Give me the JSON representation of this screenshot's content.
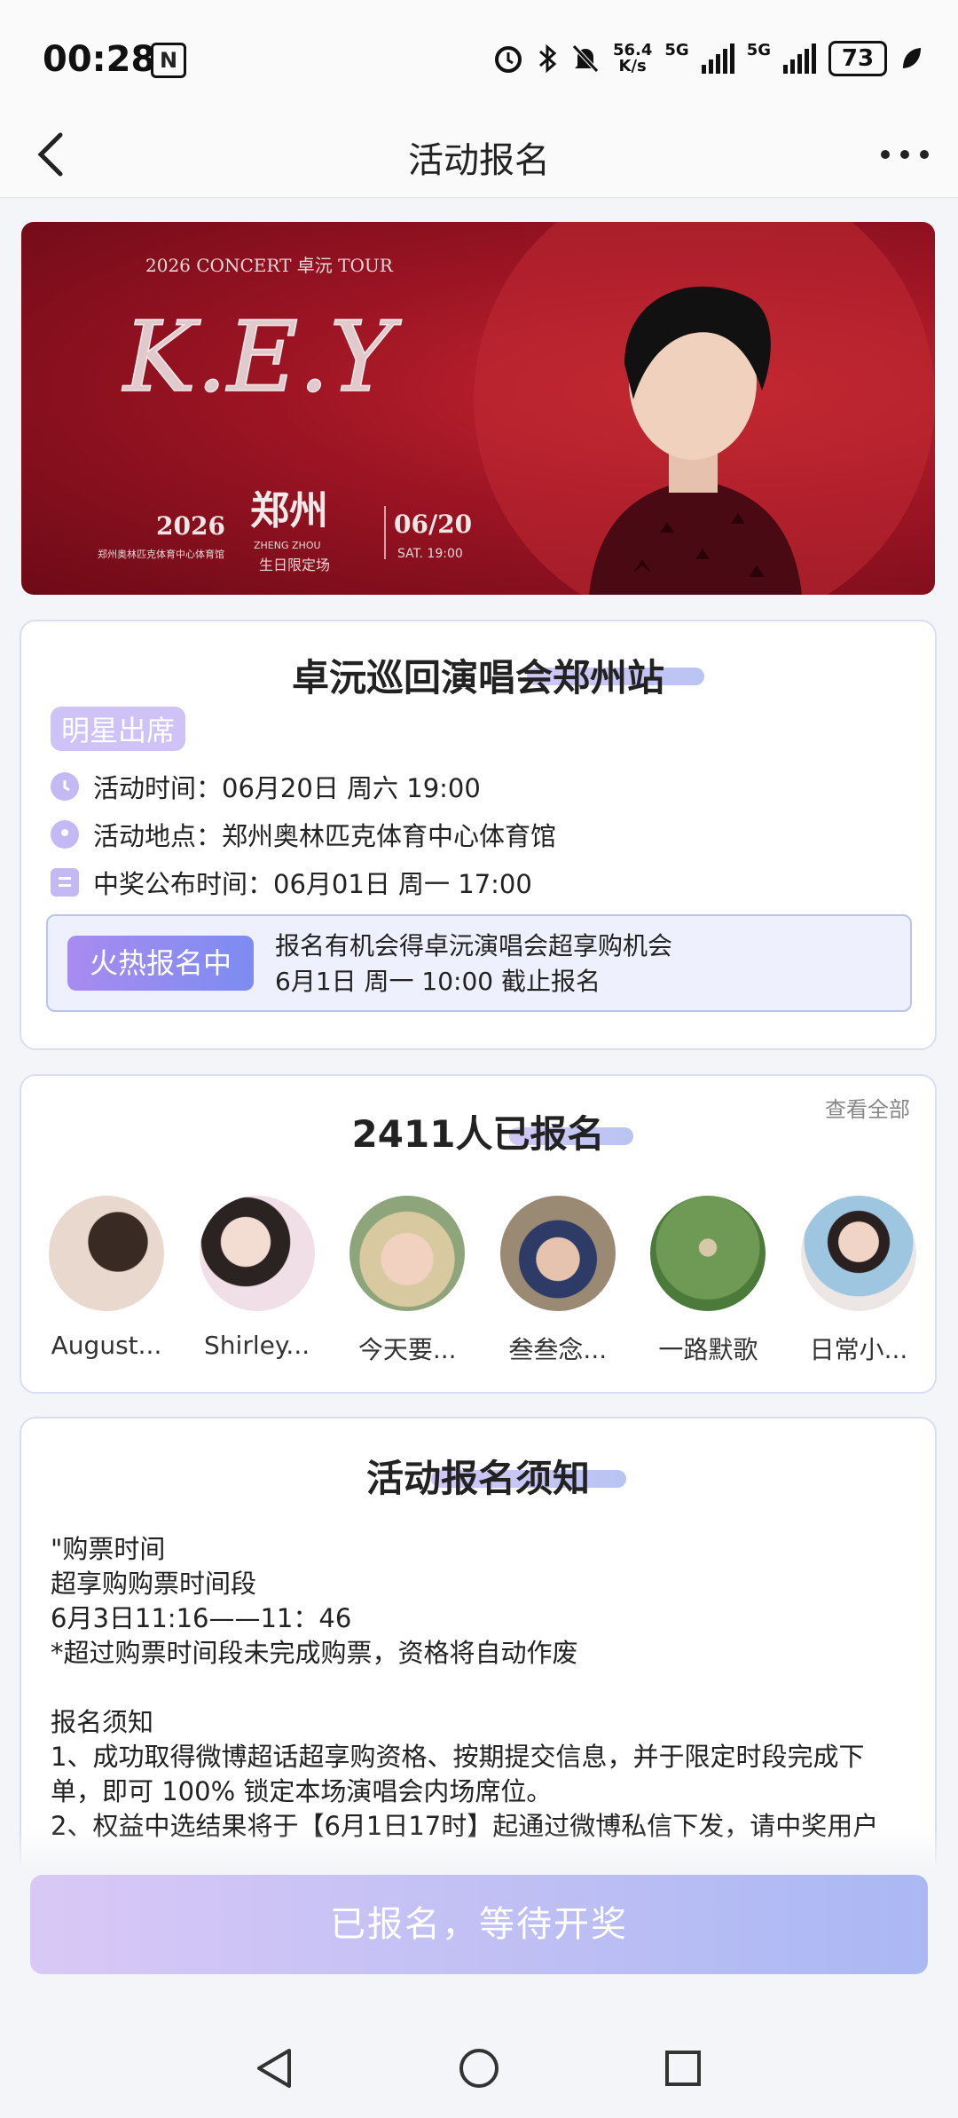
{
  "status_bar": {
    "time": "00:28",
    "nfc": "N",
    "net_speed": "56.4",
    "net_speed_unit": "K/s",
    "signal_1": "5G",
    "signal_2": "5G",
    "battery": "73"
  },
  "nav": {
    "title": "活动报名",
    "back_icon": "chevron-left-icon",
    "more_icon": "more-horizontal-icon"
  },
  "banner": {
    "tour_line": "2026 CONCERT 卓沅 TOUR",
    "logo": "K.E.Y",
    "year": "2026",
    "city": "郑州",
    "city_sub": "ZHENG ZHOU",
    "date": "06/20",
    "date_sub": "SAT. 19:00",
    "venue_small": "郑州奥林匹克体育中心体育馆",
    "special": "生日限定场"
  },
  "event": {
    "title": "卓沅巡回演唱会郑州站",
    "tag": "明星出席",
    "time_label": "活动时间：",
    "time_value": "06月20日 周六 19:00",
    "place_label": "活动地点：",
    "place_value": "郑州奥林匹克体育中心体育馆",
    "announce_label": "中奖公布时间：",
    "announce_value": "06月01日 周一 17:00",
    "hot_status": "火热报名中",
    "hot_line1": "报名有机会得卓沅演唱会超享购机会",
    "hot_line2": "6月1日 周一 10:00 截止报名"
  },
  "signups": {
    "title": "2411人已报名",
    "view_all": "查看全部",
    "users": [
      {
        "name": "August..."
      },
      {
        "name": "Shirley..."
      },
      {
        "name": "今天要..."
      },
      {
        "name": "叁叁念..."
      },
      {
        "name": "一路默歌"
      },
      {
        "name": "日常小..."
      }
    ]
  },
  "notice": {
    "title": "活动报名须知",
    "lines": [
      "\"购票时间",
      "超享购购票时间段",
      "6月3日11:16——11：46",
      "*超过购票时间段未完成购票，资格将自动作废",
      "",
      "报名须知",
      "1、成功取得微博超话超享购资格、按期提交信息，并于限定时段完成下单，即可 100% 锁定本场演唱会内场席位。",
      "2、权益中选结果将于【6月1日17时】起通过微博私信下发，请中奖用户"
    ]
  },
  "cta": {
    "label": "已报名，等待开奖"
  },
  "colors": {
    "accent": "#8f8cf0",
    "banner_red": "#9c1424",
    "tag_bg": "#cfc2f6"
  }
}
